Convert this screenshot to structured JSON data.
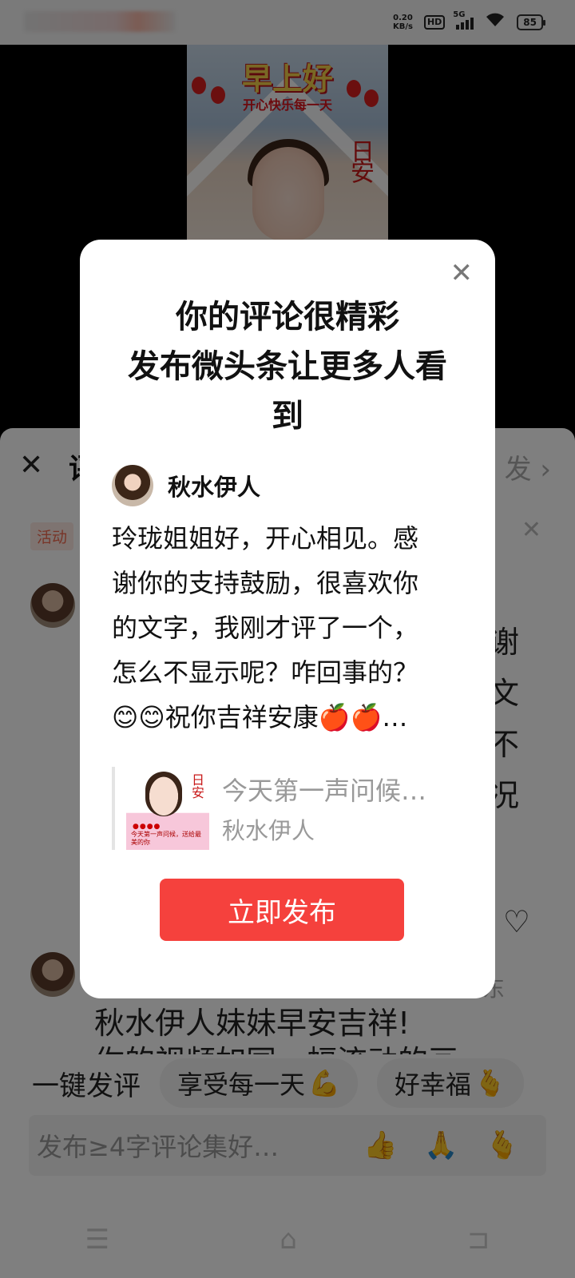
{
  "status_bar": {
    "net_speed_value": "0.20",
    "net_speed_unit": "KB/s",
    "hd_label": "HD",
    "network_label": "5G",
    "battery": "85"
  },
  "video": {
    "thumb_title": "早上好",
    "thumb_subtitle": "开心快乐每一天",
    "thumb_mark": "日安"
  },
  "sheet": {
    "title": "评",
    "right_hint": "发",
    "activity_tag": "活动",
    "side_lines": [
      "谢",
      "文",
      "不",
      "况"
    ],
    "comment2_name_fragment": "东",
    "comment2_text": "秋水伊人妹妹早安吉祥!",
    "comment2_text2": "你的视频如同一幅流动的画",
    "quick_title": "一键发评",
    "quick_chips": [
      {
        "label": "享受每一天",
        "emoji": "💪"
      },
      {
        "label": "好幸福",
        "emoji": "🫰"
      }
    ],
    "input_placeholder": "发布≥4字评论集好…",
    "input_emojis": [
      "👍",
      "🙏",
      "🫰"
    ]
  },
  "dialog": {
    "title_line1": "你的评论很精彩",
    "title_line2": "发布微头条让更多人看",
    "title_line3": "到",
    "username": "秋水伊人",
    "comment_lines": [
      "玲珑姐姐好，开心相见。感",
      "谢你的支持鼓励，很喜欢你",
      "的文字，我刚才评了一个，",
      "怎么不显示呢？咋回事的？",
      "😊😊祝你吉祥安康🍎🍎…"
    ],
    "quote_title": "今天第一声问候…",
    "quote_author": "秋水伊人",
    "quote_thumb_mark": "日安",
    "quote_thumb_text": "今天第一声问候，送给最美的你",
    "publish_button": "立即发布"
  }
}
